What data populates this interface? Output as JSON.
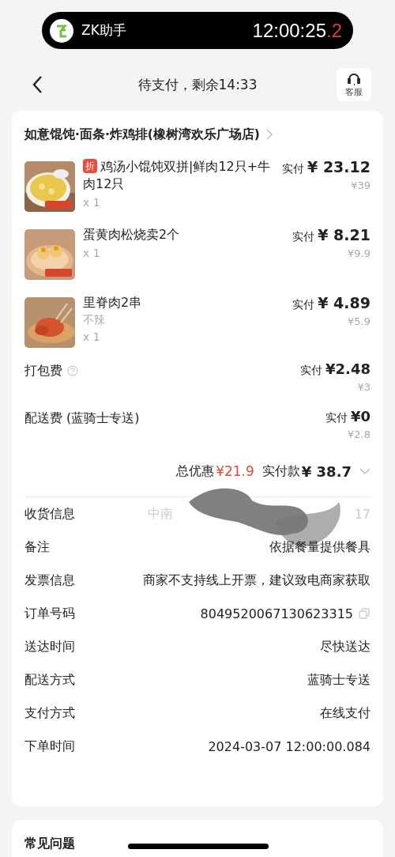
{
  "status_pill": {
    "app_name": "ZK助手",
    "time": "12:00:25",
    "time_fraction": ".2"
  },
  "nav": {
    "title": "待支付，剩余14:33",
    "service_label": "客服"
  },
  "store": {
    "name": "如意馄饨·面条·炸鸡排(橡树湾欢乐广场店)"
  },
  "items": [
    {
      "badge": "折",
      "name": "鸡汤小馄饨双拼|鲜肉12只+牛肉12只",
      "qty": "x 1",
      "paid_label": "实付",
      "paid": "¥ 23.12",
      "original": "¥39"
    },
    {
      "name": "蛋黄肉松烧卖2个",
      "qty": "x 1",
      "paid_label": "实付",
      "paid": "¥ 8.21",
      "original": "¥9.9"
    },
    {
      "name": "里脊肉2串",
      "spec": "不辣",
      "qty": "x 1",
      "paid_label": "实付",
      "paid": "¥ 4.89",
      "original": "¥5.9"
    }
  ],
  "fees": [
    {
      "label": "打包费",
      "help": true,
      "paid_label": "实付",
      "paid": "¥2.48",
      "original": "¥3"
    },
    {
      "label": "配送费 (蓝骑士专送)",
      "help": false,
      "paid_label": "实付",
      "paid": "¥0",
      "original": "¥2.8"
    }
  ],
  "summary": {
    "discount_label": "总优惠",
    "discount": "¥21.9",
    "total_label": "实付款",
    "total": "¥ 38.7"
  },
  "info": [
    {
      "label": "收货信息",
      "kind": "redacted",
      "value": "中南",
      "value_end": "17"
    },
    {
      "label": "备注",
      "kind": "text",
      "value": "依据餐量提供餐具"
    },
    {
      "label": "发票信息",
      "kind": "text",
      "value": "商家不支持线上开票，建议致电商家获取"
    },
    {
      "label": "订单号码",
      "kind": "copy",
      "value": "8049520067130623315"
    },
    {
      "label": "送达时间",
      "kind": "text",
      "value": "尽快送达"
    },
    {
      "label": "配送方式",
      "kind": "text",
      "value": "蓝骑士专送"
    },
    {
      "label": "支付方式",
      "kind": "text",
      "value": "在线支付"
    },
    {
      "label": "下单时间",
      "kind": "text",
      "value": "2024-03-07 12:00:00.084"
    }
  ],
  "faq": {
    "title": "常见问题"
  }
}
